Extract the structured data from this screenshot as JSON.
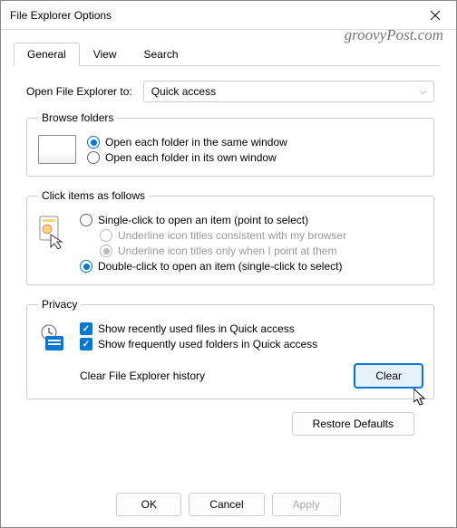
{
  "window": {
    "title": "File Explorer Options"
  },
  "watermark": "groovyPost.com",
  "tabs": {
    "general": "General",
    "view": "View",
    "search": "Search"
  },
  "open_to": {
    "label": "Open File Explorer to:",
    "value": "Quick access"
  },
  "browse": {
    "legend": "Browse folders",
    "opt1": "Open each folder in the same window",
    "opt2": "Open each folder in its own window"
  },
  "click": {
    "legend": "Click items as follows",
    "single": "Single-click to open an item (point to select)",
    "underline1": "Underline icon titles consistent with my browser",
    "underline2": "Underline icon titles only when I point at them",
    "double": "Double-click to open an item (single-click to select)"
  },
  "privacy": {
    "legend": "Privacy",
    "recent": "Show recently used files in Quick access",
    "frequent": "Show frequently used folders in Quick access",
    "clear_label": "Clear File Explorer history",
    "clear_btn": "Clear"
  },
  "buttons": {
    "restore": "Restore Defaults",
    "ok": "OK",
    "cancel": "Cancel",
    "apply": "Apply"
  }
}
